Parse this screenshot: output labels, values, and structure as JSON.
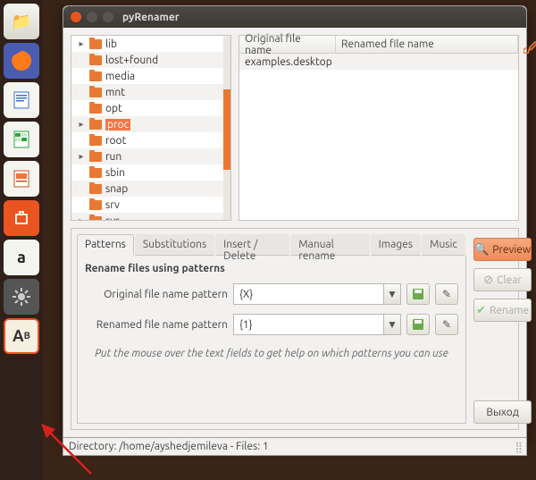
{
  "window": {
    "title": "pyRenamer"
  },
  "launcher": {
    "items": [
      {
        "name": "files"
      },
      {
        "name": "firefox"
      },
      {
        "name": "writer"
      },
      {
        "name": "calc"
      },
      {
        "name": "impress"
      },
      {
        "name": "software"
      },
      {
        "name": "amazon"
      },
      {
        "name": "settings"
      },
      {
        "name": "pyren"
      }
    ]
  },
  "tree": {
    "items": [
      {
        "label": "lib",
        "expandable": true,
        "indent": 0
      },
      {
        "label": "lost+found",
        "expandable": false,
        "indent": 1
      },
      {
        "label": "media",
        "expandable": false,
        "indent": 0
      },
      {
        "label": "mnt",
        "expandable": false,
        "indent": 1
      },
      {
        "label": "opt",
        "expandable": false,
        "indent": 1
      },
      {
        "label": "proc",
        "expandable": true,
        "indent": 0,
        "selected": true
      },
      {
        "label": "root",
        "expandable": false,
        "indent": 1
      },
      {
        "label": "run",
        "expandable": true,
        "indent": 0
      },
      {
        "label": "sbin",
        "expandable": false,
        "indent": 1
      },
      {
        "label": "snap",
        "expandable": false,
        "indent": 1
      },
      {
        "label": "srv",
        "expandable": false,
        "indent": 0
      },
      {
        "label": "sys",
        "expandable": true,
        "indent": 0
      }
    ]
  },
  "filelist": {
    "col1": "Original file name",
    "col2": "Renamed file name",
    "rows": [
      {
        "original": "examples.desktop",
        "renamed": ""
      }
    ]
  },
  "tabs": {
    "items": [
      "Patterns",
      "Substitutions",
      "Insert / Delete",
      "Manual rename",
      "Images",
      "Music"
    ],
    "active": 0
  },
  "patterns": {
    "heading": "Rename files using patterns",
    "orig_label": "Original file name pattern",
    "orig_value": "{X}",
    "ren_label": "Renamed file name pattern",
    "ren_value": "{1}",
    "hint": "Put the mouse over the text fields to get help on which patterns you can use"
  },
  "buttons": {
    "preview": "Preview",
    "clear": "Clear",
    "rename": "Rename",
    "exit": "Выход"
  },
  "status": {
    "text": "Directory: /home/ayshedjemileva - Files: 1"
  }
}
